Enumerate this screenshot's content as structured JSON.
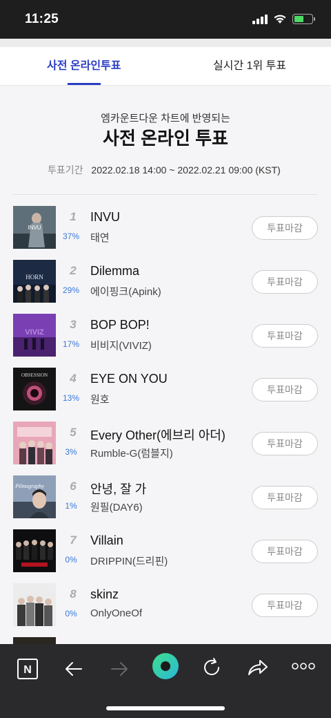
{
  "status_bar": {
    "time": "11:25"
  },
  "tabs": [
    {
      "label": "사전 온라인투표",
      "active": true
    },
    {
      "label": "실시간 1위 투표",
      "active": false
    }
  ],
  "header": {
    "subtitle": "엠카운트다운 차트에 반영되는",
    "title": "사전 온라인 투표",
    "period_label": "투표기간",
    "period_value": "2022.02.18 14:00 ~ 2022.02.21 09:00 (KST)"
  },
  "vote_button_label": "투표마감",
  "items": [
    {
      "rank": "1",
      "percent": "37%",
      "title": "INVU",
      "artist": "태연",
      "cover_text": "INVU"
    },
    {
      "rank": "2",
      "percent": "29%",
      "title": "Dilemma",
      "artist": "에이핑크(Apink)",
      "cover_text": "HORN"
    },
    {
      "rank": "3",
      "percent": "17%",
      "title": "BOP BOP!",
      "artist": "비비지(VIVIZ)",
      "cover_text": "VIVIZ"
    },
    {
      "rank": "4",
      "percent": "13%",
      "title": "EYE ON YOU",
      "artist": "원호",
      "cover_text": "OBSESSION"
    },
    {
      "rank": "5",
      "percent": "3%",
      "title": "Every Other(에브리 아더)",
      "artist": "Rumble-G(럼블지)",
      "cover_text": ""
    },
    {
      "rank": "6",
      "percent": "1%",
      "title": "안녕, 잘 가",
      "artist": "원필(DAY6)",
      "cover_text": "Pilmography"
    },
    {
      "rank": "7",
      "percent": "0%",
      "title": "Villain",
      "artist": "DRIPPIN(드리핀)",
      "cover_text": ""
    },
    {
      "rank": "8",
      "percent": "0%",
      "title": "skinz",
      "artist": "OnlyOneOf",
      "cover_text": ""
    }
  ],
  "nav": {
    "naver_logo": "N"
  },
  "colors": {
    "accent": "#2b3cc4",
    "percent": "#3a78d8",
    "nav_bg": "#2a2a2c"
  }
}
